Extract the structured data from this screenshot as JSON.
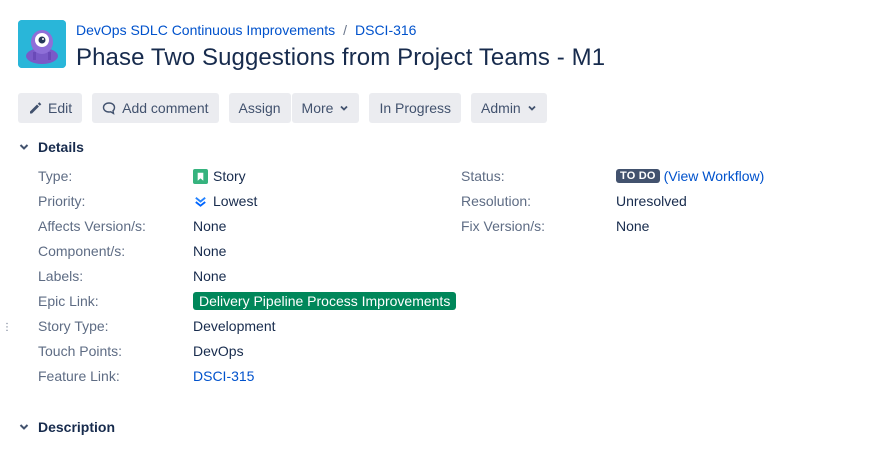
{
  "header": {
    "breadcrumb_project": "DevOps SDLC Continuous Improvements",
    "breadcrumb_separator": "/",
    "breadcrumb_issue": "DSCI-316",
    "title": "Phase Two Suggestions from Project Teams - M1"
  },
  "toolbar": {
    "edit": "Edit",
    "add_comment": "Add comment",
    "assign": "Assign",
    "more": "More",
    "in_progress": "In Progress",
    "admin": "Admin"
  },
  "details": {
    "heading": "Details",
    "type_label": "Type:",
    "type_value": "Story",
    "priority_label": "Priority:",
    "priority_value": "Lowest",
    "affects_label": "Affects Version/s:",
    "affects_value": "None",
    "component_label": "Component/s:",
    "component_value": "None",
    "labels_label": "Labels:",
    "labels_value": "None",
    "epic_label": "Epic Link:",
    "epic_value": "Delivery Pipeline Process Improvements",
    "story_type_label": "Story Type:",
    "story_type_value": "Development",
    "touch_points_label": "Touch Points:",
    "touch_points_value": "DevOps",
    "feature_link_label": "Feature Link:",
    "feature_link_value": "DSCI-315",
    "status_label": "Status:",
    "status_value": "TO DO",
    "view_workflow": "(View Workflow)",
    "resolution_label": "Resolution:",
    "resolution_value": "Unresolved",
    "fix_version_label": "Fix Version/s:",
    "fix_version_value": "None"
  },
  "description": {
    "heading": "Description"
  },
  "colors": {
    "link": "#0052cc",
    "story_icon": "#36b37e",
    "priority_icon": "#2684ff",
    "epic_badge": "#00875a",
    "status_lozenge": "#42526e",
    "button_bg": "#ebecf0"
  },
  "icons": {
    "avatar": "project-avatar-icon",
    "edit": "pencil-icon",
    "comment": "speech-bubble-icon",
    "caret": "chevron-down-icon",
    "story": "story-bookmark-icon",
    "priority": "double-chevron-down-icon"
  }
}
